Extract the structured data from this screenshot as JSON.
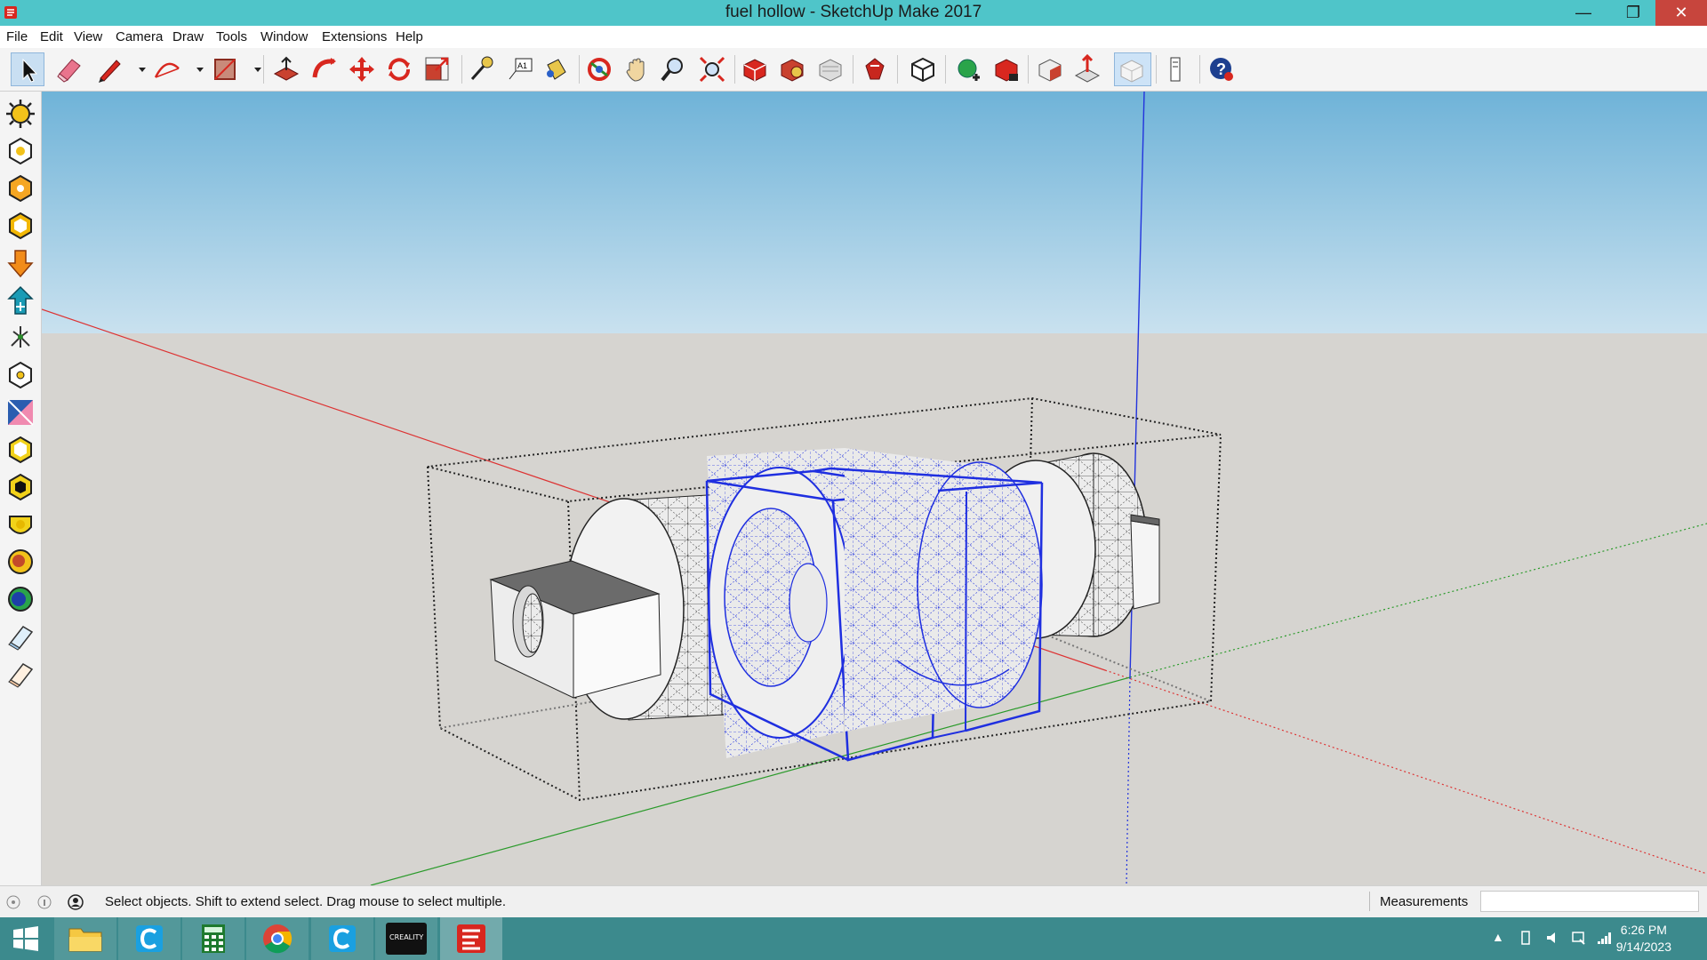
{
  "window": {
    "title": "fuel hollow - SketchUp Make 2017",
    "controls": {
      "minimize": "—",
      "restore": "❐",
      "close": "✕"
    }
  },
  "menu": {
    "items": [
      "File",
      "Edit",
      "View",
      "Camera",
      "Draw",
      "Tools",
      "Window",
      "Extensions",
      "Help"
    ]
  },
  "toolbar": {
    "tools": [
      "select-icon",
      "eraser-icon",
      "pencil-icon",
      "arc-icon",
      "rectangle-icon",
      "push-pull-icon",
      "follow-me-icon",
      "move-icon",
      "rotate-icon",
      "scale-icon",
      "tape-measure-icon",
      "text-icon",
      "paint-bucket-icon",
      "orbit-icon",
      "pan-icon",
      "zoom-icon",
      "zoom-extents-icon",
      "3d-warehouse-icon",
      "extension-warehouse-icon",
      "layout-icon",
      "extension-manager-icon",
      "components-icon",
      "add-location-icon",
      "toggle-terrain-icon",
      "photo-textures-icon",
      "preview-google-earth-icon",
      "xray-icon",
      "model-info-icon",
      "help-icon"
    ]
  },
  "left_toolbar": {
    "tools": [
      "shadows-icon",
      "sandbox-from-contours-icon",
      "sandbox-from-scratch-icon",
      "sandbox-smoove-icon",
      "sandbox-stamp-icon",
      "sandbox-drape-icon",
      "sandbox-add-detail-icon",
      "sandbox-flip-edge-icon",
      "section-plane-icon",
      "outer-shell-icon",
      "intersect-icon",
      "union-icon",
      "subtract-icon",
      "trim-icon",
      "split-icon",
      "eraser-3d-icon"
    ]
  },
  "status": {
    "message": "Select objects. Shift to extend select. Drag mouse to select multiple.",
    "measurements_label": "Measurements",
    "measurements_value": ""
  },
  "taskbar": {
    "apps": [
      "windows-start-icon",
      "file-explorer-icon",
      "cura-icon",
      "calculator-icon",
      "chrome-icon",
      "cura-alt-icon",
      "creality-icon",
      "sketchup-icon"
    ],
    "creality_label": "CREALITY",
    "tray_arrow": "▲",
    "time": "6:26 PM",
    "date": "9/14/2023"
  },
  "colors": {
    "titlebar": "#4fc5c9",
    "sky_top": "#6fb3d8",
    "sky_bottom": "#c9e1ef",
    "ground": "#d6d4d0",
    "selection": "#1f2fe0",
    "taskbar": "#3c8a8d"
  }
}
